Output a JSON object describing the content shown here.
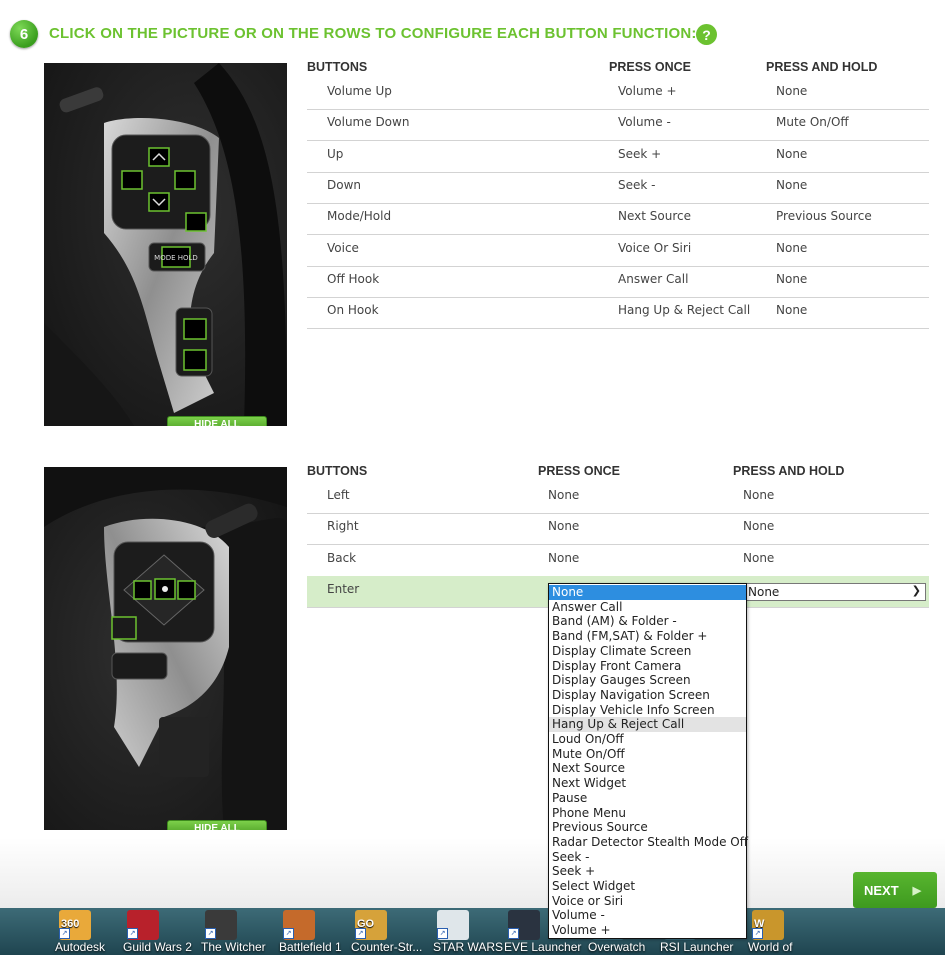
{
  "step": {
    "number": "6",
    "title": "CLICK ON THE PICTURE OR ON THE ROWS TO CONFIGURE EACH BUTTON FUNCTION:",
    "help": "?"
  },
  "table_headers": {
    "buttons": "BUTTONS",
    "press_once": "PRESS ONCE",
    "press_hold": "PRESS AND HOLD"
  },
  "hide_all_label": "HIDE ALL",
  "panel1": {
    "photo_labels": {
      "mode_hold": "MODE HOLD"
    },
    "rows": [
      {
        "button": "Volume Up",
        "once": "Volume +",
        "hold": "None"
      },
      {
        "button": "Volume Down",
        "once": "Volume -",
        "hold": "Mute On/Off"
      },
      {
        "button": "Up",
        "once": "Seek +",
        "hold": "None"
      },
      {
        "button": "Down",
        "once": "Seek -",
        "hold": "None"
      },
      {
        "button": "Mode/Hold",
        "once": "Next Source",
        "hold": "Previous Source"
      },
      {
        "button": "Voice",
        "once": "Voice Or Siri",
        "hold": "None"
      },
      {
        "button": "Off Hook",
        "once": "Answer Call",
        "hold": "None"
      },
      {
        "button": "On Hook",
        "once": "Hang Up & Reject Call",
        "hold": "None"
      }
    ]
  },
  "panel2": {
    "rows": [
      {
        "button": "Left",
        "once": "None",
        "hold": "None"
      },
      {
        "button": "Right",
        "once": "None",
        "hold": "None"
      },
      {
        "button": "Back",
        "once": "None",
        "hold": "None"
      },
      {
        "button": "Enter",
        "once": "",
        "hold": ""
      }
    ],
    "hold_select_value": "None"
  },
  "dropdown": {
    "selected": "None",
    "highlighted": "Hang Up & Reject Call",
    "options": [
      "None",
      "Answer Call",
      "Band (AM) & Folder -",
      "Band (FM,SAT) & Folder +",
      "Display Climate Screen",
      "Display Front Camera",
      "Display Gauges Screen",
      "Display Navigation Screen",
      "Display Vehicle Info Screen",
      "Hang Up & Reject Call",
      "Loud On/Off",
      "Mute On/Off",
      "Next Source",
      "Next Widget",
      "Pause",
      "Phone Menu",
      "Previous Source",
      "Radar Detector Stealth Mode Off",
      "Seek -",
      "Seek +",
      "Select Widget",
      "Voice or Siri",
      "Volume -",
      "Volume +"
    ]
  },
  "next_label": "NEXT",
  "taskbar": [
    {
      "label": "Autodesk",
      "badge": "360",
      "color": "#e9a93a"
    },
    {
      "label": "Guild Wars 2",
      "color": "#b8212b"
    },
    {
      "label": "The Witcher",
      "color": "#3a3a3a"
    },
    {
      "label": "Battlefield 1",
      "color": "#c56a2b"
    },
    {
      "label": "Counter-Str...",
      "badge": "GO",
      "color": "#d6a23a"
    },
    {
      "label": "STAR WARS",
      "color": "#dfe6ea"
    },
    {
      "label": "EVE Launcher",
      "color": "#2a3340"
    },
    {
      "label": "Overwatch",
      "color": "#3a6f80"
    },
    {
      "label": "RSI Launcher",
      "color": "#3a6f80"
    },
    {
      "label": "World of",
      "badge": "W",
      "color": "#c9962c"
    }
  ]
}
